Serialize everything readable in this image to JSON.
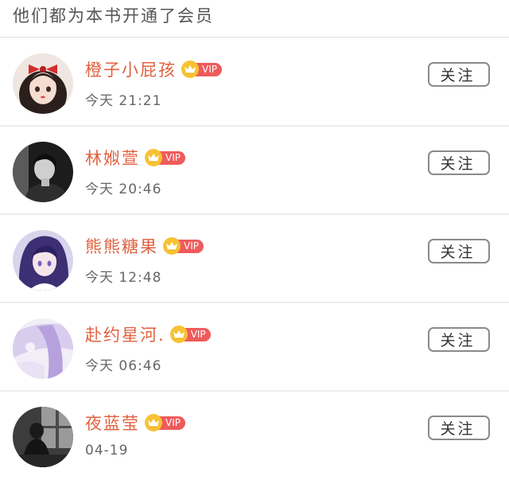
{
  "header": {
    "title": "他们都为本书开通了会员"
  },
  "members": [
    {
      "name": "橙子小屁孩",
      "badge": "VIP",
      "time": "今天 21:21",
      "follow_label": "关注",
      "avatar_icon": "avatar-girl-red-bow"
    },
    {
      "name": "林娰萱",
      "badge": "VIP",
      "time": "今天 20:46",
      "follow_label": "关注",
      "avatar_icon": "avatar-grayscale-portrait"
    },
    {
      "name": "熊熊糖果",
      "badge": "VIP",
      "time": "今天 12:48",
      "follow_label": "关注",
      "avatar_icon": "avatar-anime-purple-hair"
    },
    {
      "name": "赴约星河.",
      "badge": "VIP",
      "time": "今天 06:46",
      "follow_label": "关注",
      "avatar_icon": "avatar-lavender-soft"
    },
    {
      "name": "夜蓝莹",
      "badge": "VIP",
      "time": "04-19",
      "follow_label": "关注",
      "avatar_icon": "avatar-window-silhouette"
    }
  ],
  "colors": {
    "name": "#e0603f",
    "vip_badge": "#ef5b5b",
    "crown": "#f7c233",
    "button_border": "#8a8a8a",
    "divider": "#ececec"
  }
}
